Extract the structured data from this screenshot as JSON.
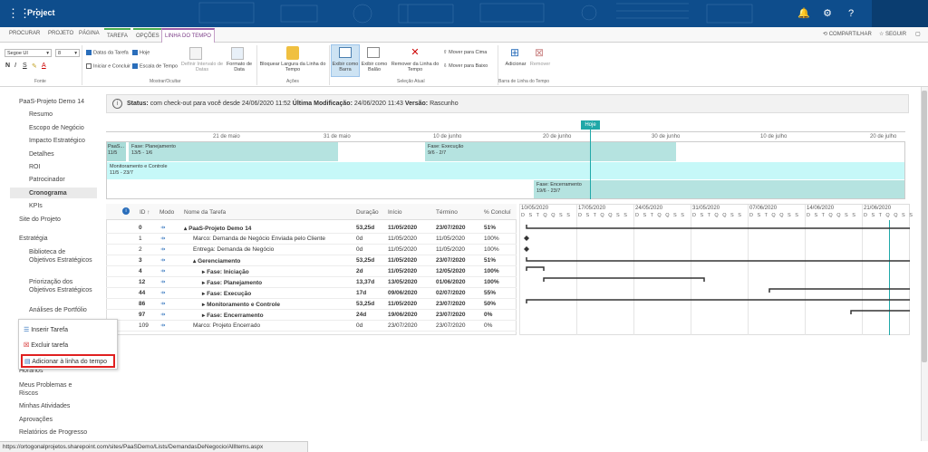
{
  "app": {
    "title": "Project"
  },
  "tabs": [
    "PROCURAR",
    "PROJETO",
    "PÁGINA",
    "TAREFA",
    "OPÇÕES",
    "LINHA DO TEMPO"
  ],
  "top_right": {
    "share": "COMPARTILHAR",
    "follow": "SEGUIR"
  },
  "ribbon": {
    "font_name": "Segoe UI",
    "font_size": "8",
    "font_label": "Fonte",
    "dates_task": "Datas da Tarefa",
    "today": "Hoje",
    "start_end": "Iniciar e Concluir",
    "timescale": "Escala de Tempo",
    "set_interval": "Definir Intervalo de Datas",
    "date_format": "Formato de Data",
    "show_hide_label": "Mostrar/Ocultar",
    "lock_width": "Bloquear Largura da Linha do Tempo",
    "actions_label": "Ações",
    "show_bar": "Exibir como Barra",
    "show_callout": "Exibir como Balão",
    "remove_timeline": "Remover da Linha do Tempo",
    "selection_label": "Seleção Atual",
    "move_up": "Mover para Cima",
    "move_down": "Mover para Baixo",
    "add": "Adicionar",
    "remove": "Remover",
    "bar_label": "Barra de Linha do Tempo"
  },
  "sidebar": {
    "items": [
      "PaaS-Projeto Demo 14",
      "Resumo",
      "Escopo de Negócio",
      "Impacto Estratégico",
      "Detalhes",
      "ROI",
      "Patrocinador",
      "Cronograma",
      "KPIs",
      "Site do Projeto",
      "Estratégia",
      "Biblioteca de Objetivos Estratégicos",
      "Priorização dos Objetivos Estratégicos",
      "Análises de Portfólio",
      "Horários",
      "Meus Problemas e Riscos",
      "Minhas Atividades",
      "Aprovações",
      "Relatórios de Progresso"
    ]
  },
  "status": {
    "label": "Status:",
    "text1": "com check-out para você desde 24/06/2020 11:52",
    "modified_label": "Última Modificação:",
    "modified": "24/06/2020 11:43",
    "version_label": "Versão:",
    "version": "Rascunho"
  },
  "timeline": {
    "today_label": "Hoje",
    "dates": [
      "21 de maio",
      "31 de maio",
      "10 de junho",
      "20 de junho",
      "30 de junho",
      "10 de julho",
      "20 de julho"
    ],
    "bars": [
      {
        "name": "PaaS...",
        "dates": "11/5"
      },
      {
        "name": "Fase: Planejamento",
        "dates": "13/5 - 1/6"
      },
      {
        "name": "Fase: Execução",
        "dates": "9/6 - 2/7"
      },
      {
        "name": "Monitoramento e Controle",
        "dates": "11/5 - 23/7"
      },
      {
        "name": "Fase: Encerramento",
        "dates": "19/6 - 23/7"
      }
    ]
  },
  "grid": {
    "headers": [
      "ID ↑",
      "Modo",
      "Nome da Tarefa",
      "Duração",
      "Início",
      "Término",
      "% Concluí"
    ],
    "rows": [
      {
        "id": "0",
        "name": "▴ PaaS-Projeto Demo 14",
        "dur": "53,25d",
        "start": "11/05/2020",
        "end": "23/07/2020",
        "pct": "51%",
        "bold": true,
        "indent": 0
      },
      {
        "id": "1",
        "name": "Marco: Demanda de Negócio Enviada pelo Cliente",
        "dur": "0d",
        "start": "11/05/2020",
        "end": "11/05/2020",
        "pct": "100%",
        "bold": false,
        "indent": 1
      },
      {
        "id": "2",
        "name": "Entrega: Demanda de Negócio",
        "dur": "0d",
        "start": "11/05/2020",
        "end": "11/05/2020",
        "pct": "100%",
        "bold": false,
        "indent": 1
      },
      {
        "id": "3",
        "name": "▴ Gerenciamento",
        "dur": "53,25d",
        "start": "11/05/2020",
        "end": "23/07/2020",
        "pct": "51%",
        "bold": true,
        "indent": 1
      },
      {
        "id": "4",
        "name": "▸ Fase: Iniciação",
        "dur": "2d",
        "start": "11/05/2020",
        "end": "12/05/2020",
        "pct": "100%",
        "bold": true,
        "indent": 2
      },
      {
        "id": "12",
        "name": "▸ Fase: Planejamento",
        "dur": "13,37d",
        "start": "13/05/2020",
        "end": "01/06/2020",
        "pct": "100%",
        "bold": true,
        "indent": 2
      },
      {
        "id": "44",
        "name": "▸ Fase: Execução",
        "dur": "17d",
        "start": "09/06/2020",
        "end": "02/07/2020",
        "pct": "55%",
        "bold": true,
        "indent": 2
      },
      {
        "id": "86",
        "name": "▸ Monitoramento e Controle",
        "dur": "53,25d",
        "start": "11/05/2020",
        "end": "23/07/2020",
        "pct": "50%",
        "bold": true,
        "indent": 2
      },
      {
        "id": "97",
        "name": "▸ Fase: Encerramento",
        "dur": "24d",
        "start": "19/06/2020",
        "end": "23/07/2020",
        "pct": "0%",
        "bold": true,
        "indent": 2
      },
      {
        "id": "109",
        "name": "Marco: Projeto Encerrado",
        "dur": "0d",
        "start": "23/07/2020",
        "end": "23/07/2020",
        "pct": "0%",
        "bold": false,
        "indent": 1
      }
    ]
  },
  "gantt": {
    "weeks": [
      "10/05/2020",
      "17/05/2020",
      "24/05/2020",
      "31/05/2020",
      "07/06/2020",
      "14/06/2020",
      "21/06/2020"
    ],
    "days": "D S T Q Q S S"
  },
  "popup": {
    "insert": "Inserir Tarefa",
    "delete": "Excluir tarefa",
    "add_timeline": "Adicionar à linha do tempo"
  },
  "url": "https://ortogonalprojetos.sharepoint.com/sites/PaaSDemo/Lists/DemandasDeNegocio/AllItems.aspx",
  "colors": {
    "header": "#0e4d8c",
    "timeline": "#b5e3e0",
    "today": "#20a8a8",
    "highlight": "#e02020"
  }
}
